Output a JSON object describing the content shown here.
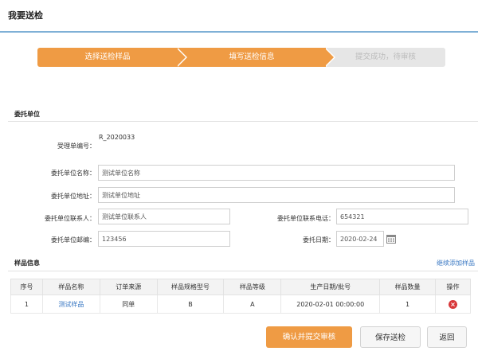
{
  "page_title": "我要送检",
  "steps": [
    {
      "label": "选择送检样品"
    },
    {
      "label": "填写送检信息"
    },
    {
      "label": "提交成功，待审核"
    }
  ],
  "client_section": {
    "title": "委托单位",
    "accept_no_label": "受理单编号：",
    "accept_no_value": "R_2020033",
    "name_label": "委托单位名称：",
    "name_value": "测试单位名称",
    "address_label": "委托单位地址：",
    "address_value": "测试单位地址",
    "contact_label": "委托单位联系人：",
    "contact_value": "测试单位联系人",
    "phone_label": "委托单位联系电话：",
    "phone_value": "654321",
    "email_label": "委托单位邮编：",
    "email_value": "123456",
    "date_label": "委托日期：",
    "date_value": "2020-02-24"
  },
  "samples_section": {
    "title": "样品信息",
    "add_link": "继续添加样品",
    "columns": [
      "序号",
      "样品名称",
      "订单来源",
      "样品规格型号",
      "样品等级",
      "生产日期/批号",
      "样品数量",
      "操作"
    ],
    "rows": [
      {
        "index": "1",
        "name": "测试样品",
        "source": "同单",
        "model": "B",
        "grade": "A",
        "date": "2020-02-01 00:00:00",
        "qty": "1"
      }
    ]
  },
  "actions": {
    "submit": "确认并提交审核",
    "save": "保存送检",
    "back": "返回"
  },
  "colors": {
    "accent": "#ef9b44",
    "link": "#3a78c3",
    "delete": "#d8383a"
  }
}
